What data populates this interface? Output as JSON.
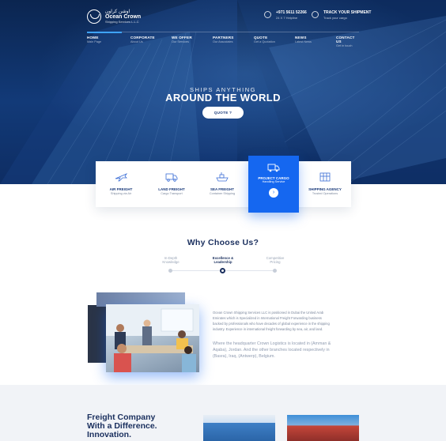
{
  "brand": {
    "name_ar": "اوشن كراون",
    "name_en_line1": "Ocean Crown",
    "name_en_line2": "Shipping Services L.L.C"
  },
  "topbar": {
    "phone": "+971 5611 52266",
    "phone_sub": "24 X 7 Helpline",
    "track": "TRACK YOUR SHIPMENT",
    "track_sub": "Track your cargo"
  },
  "nav": [
    {
      "label": "HOME",
      "sub": "Main Page"
    },
    {
      "label": "CORPORATE",
      "sub": "About Us"
    },
    {
      "label": "WE OFFER",
      "sub": "Our Services"
    },
    {
      "label": "PARTNERS",
      "sub": "Our Associates"
    },
    {
      "label": "QUOTE",
      "sub": "Get a Quotation"
    },
    {
      "label": "NEWS",
      "sub": "Latest News"
    },
    {
      "label": "CONTACT US",
      "sub": "Get in touch"
    }
  ],
  "hero": {
    "subtitle": "SHIPS ANYTHING",
    "title": "AROUND THE WORLD",
    "button": "QUOTE ?"
  },
  "services": [
    {
      "name": "AIR FREIGHT",
      "sub": "Shipping via Air",
      "icon": "airplane-icon"
    },
    {
      "name": "LAND FREIGHT",
      "sub": "Cargo Transport",
      "icon": "truck-icon"
    },
    {
      "name": "SEA FREIGHT",
      "sub": "Container Shipping",
      "icon": "ship-icon"
    },
    {
      "name": "PROJECT CARGO",
      "sub": "Handling Service",
      "icon": "cargo-truck-icon"
    },
    {
      "name": "SHIPPING AGENCY",
      "sub": "Trusted Operations",
      "icon": "agency-icon"
    }
  ],
  "why": {
    "title": "Why Choose Us?",
    "steps": [
      {
        "line1": "In-Depth",
        "line2": "Knowledge"
      },
      {
        "line1": "Excellence &",
        "line2": "Leadership"
      },
      {
        "line1": "Competitive",
        "line2": "Pricing"
      }
    ]
  },
  "about": {
    "p1": "Ocean Crown Shipping Services LLC is positioned in Dubai the United Arab Emirates which is Specialized in International Freight Forwarding business backed by professionals who have decades of global experience in the shipping industry. Experience in international freight forwarding by sea, air, and land.",
    "p2": "Where the headquarter Crown Logistics is located in (Amman & Aqaba), Jordan. And the other branches located respectively in (Basra), Iraq, (Antwerp), Belgium."
  },
  "bottom": {
    "title_l1": "Freight Company",
    "title_l2": "With a Difference.",
    "title_l3": "Innovation."
  },
  "colors": {
    "accent": "#1567f0",
    "navy": "#1a2f5e",
    "hero_dark": "#0b2550"
  }
}
